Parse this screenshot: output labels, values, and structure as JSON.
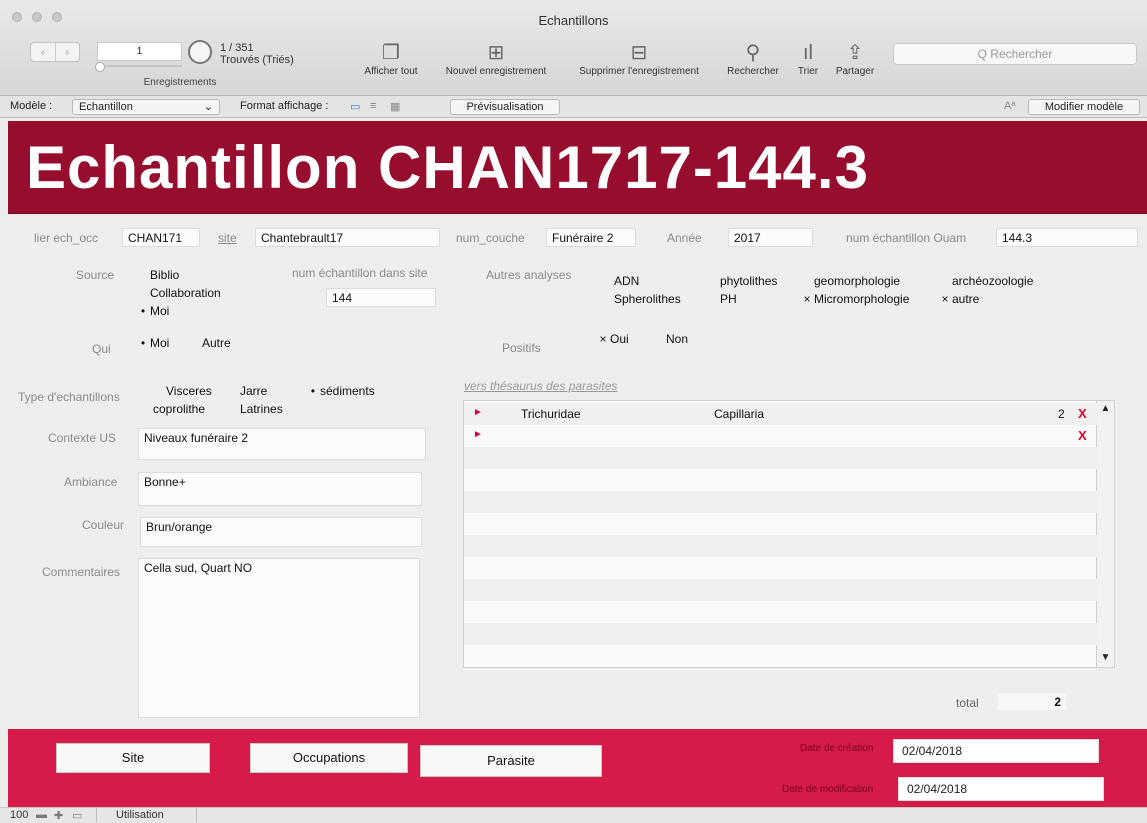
{
  "window": {
    "title": "Echantillons"
  },
  "toolbar": {
    "record_value": "1",
    "record_label": "Enregistrements",
    "counter_total": "1 / 351",
    "counter_state": "Trouvés (Triés)",
    "show_all": "Afficher tout",
    "new_record": "Nouvel enregistrement",
    "delete_record": "Supprimer l'enregistrement",
    "find": "Rechercher",
    "sort": "Trier",
    "share": "Partager",
    "search_placeholder": "Q Rechercher"
  },
  "layoutbar": {
    "model_label": "Modèle :",
    "model_value": "Echantillon",
    "format_label": "Format affichage :",
    "preview": "Prévisualisation",
    "aa": "Aª",
    "edit_layout": "Modifier modèle"
  },
  "header": {
    "title": "Echantillon CHAN1717-144.3"
  },
  "form": {
    "lier_label": "lier ech_occ",
    "lier_value": "CHAN171",
    "site_label": "site",
    "site_value": "Chantebrault17",
    "num_couche_label": "num_couche",
    "num_couche_value": "Funéraire 2",
    "annee_label": "Année",
    "annee_value": "2017",
    "num_ouam_label": "num échantillon Ouam",
    "num_ouam_value": "144.3",
    "source_label": "Source",
    "source_options": [
      {
        "label": "Biblio",
        "mark": ""
      },
      {
        "label": "Collaboration",
        "mark": ""
      },
      {
        "label": "Moi",
        "mark": "•"
      }
    ],
    "num_site_label": "num échantillon dans site",
    "num_site_value": "144",
    "autres_label": "Autres analyses",
    "autres_options": [
      {
        "label": "ADN",
        "mark": ""
      },
      {
        "label": "phytolithes",
        "mark": ""
      },
      {
        "label": "geomorphologie",
        "mark": ""
      },
      {
        "label": "archéozoologie",
        "mark": ""
      },
      {
        "label": "Spherolithes",
        "mark": ""
      },
      {
        "label": "PH",
        "mark": ""
      },
      {
        "label": "Micromorphologie",
        "mark": "×"
      },
      {
        "label": "autre",
        "mark": "×"
      }
    ],
    "qui_label": "Qui",
    "qui_options": [
      {
        "label": "Moi",
        "mark": "•"
      },
      {
        "label": "Autre",
        "mark": ""
      }
    ],
    "positifs_label": "Positifs",
    "positifs_options": [
      {
        "label": "Oui",
        "mark": "×"
      },
      {
        "label": "Non",
        "mark": ""
      }
    ],
    "type_label": "Type d'echantillons",
    "type_options": [
      {
        "label": "Visceres",
        "mark": ""
      },
      {
        "label": "Jarre",
        "mark": ""
      },
      {
        "label": "sédiments",
        "mark": "•"
      },
      {
        "label": "coprolithe",
        "mark": ""
      },
      {
        "label": "Latrines",
        "mark": ""
      }
    ],
    "thesaurus_link": "vers thésaurus des parasites",
    "contexte_label": "Contexte US",
    "contexte_value": "Niveaux funéraire 2",
    "ambiance_label": "Ambiance",
    "ambiance_value": "Bonne+",
    "couleur_label": "Couleur",
    "couleur_value": "Brun/orange",
    "commentaires_label": "Commentaires",
    "commentaires_value": "Cella sud, Quart NO",
    "parasites": [
      {
        "family": "Trichuridae",
        "genus": "Capillaria",
        "count": "2",
        "delete": "X"
      },
      {
        "family": "",
        "genus": "",
        "count": "",
        "delete": "X"
      }
    ],
    "total_label": "total",
    "total_value": "2"
  },
  "footer": {
    "site_btn": "Site",
    "occupations_btn": "Occupations",
    "parasite_btn": "Parasite",
    "creation_label": "Date de création",
    "creation_value": "02/04/2018",
    "modif_label": "Date de modification",
    "modif_value": "02/04/2018"
  },
  "status": {
    "zoom": "100",
    "mode": "Utilisation"
  },
  "colors": {
    "header": "#970d2d",
    "footer": "#d61b4a",
    "delete": "#e0002b"
  }
}
